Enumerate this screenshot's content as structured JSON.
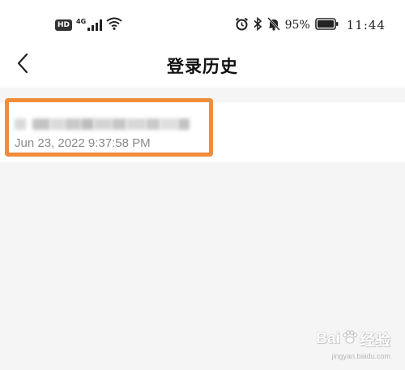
{
  "status_bar": {
    "hd_badge": "HD",
    "network": "4G",
    "battery_percent": "95%",
    "time": "11:44",
    "icons": [
      "hd-icon",
      "signal-icon",
      "wifi-icon",
      "alarm-icon",
      "bluetooth-icon",
      "mute-icon",
      "battery-icon"
    ]
  },
  "header": {
    "back_icon": "chevron-left-icon",
    "title": "登录历史"
  },
  "history": {
    "items": [
      {
        "account": "",
        "account_masked": true,
        "time": "Jun 23, 2022 9:37:58 PM"
      }
    ]
  },
  "colors": {
    "highlight": "#f08c3a",
    "background": "#f5f5f5",
    "secondary_text": "#8a8a8a"
  },
  "watermark": {
    "brand": "Bai",
    "brand_suffix": "经验",
    "url": "jingyan.baidu.com"
  }
}
